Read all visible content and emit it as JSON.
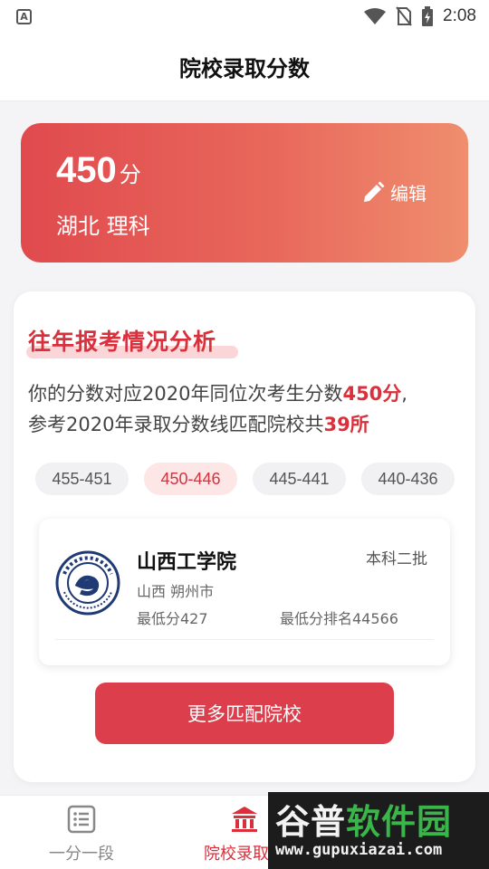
{
  "status_bar": {
    "notification_letter": "A",
    "time": "2:08"
  },
  "header": {
    "title": "院校录取分数"
  },
  "score_card": {
    "score": "450",
    "unit": "分",
    "region": "湖北 理科",
    "edit_label": "编辑"
  },
  "analysis": {
    "section_title": "往年报考情况分析",
    "line1_prefix": "你的分数对应2020年同位次考生分数",
    "line1_score": "450分",
    "line1_suffix": ",",
    "line2_prefix": "参考2020年录取分数线匹配院校共",
    "line2_count": "39所"
  },
  "ranges": [
    {
      "label": "455-451",
      "active": false
    },
    {
      "label": "450-446",
      "active": true
    },
    {
      "label": "445-441",
      "active": false
    },
    {
      "label": "440-436",
      "active": false
    }
  ],
  "school": {
    "name": "山西工学院",
    "batch": "本科二批",
    "location": "山西 朔州市",
    "min_score": "最低分427",
    "min_rank": "最低分排名44566",
    "logo_icon": "school-seal-icon"
  },
  "more_button": "更多匹配院校",
  "bottom_nav": {
    "items": [
      {
        "label": "一分一段",
        "icon": "list-icon"
      },
      {
        "label": "院校录取分",
        "icon": "school-building-icon"
      }
    ]
  },
  "watermark": {
    "title_a": "谷普",
    "title_b": "软件园",
    "url": "www.gupuxiazai.com"
  },
  "colors": {
    "accent": "#d9303c",
    "card_gradient_start": "#e04a4e",
    "card_gradient_end": "#ef8e6e",
    "button": "#dd3e4c"
  }
}
